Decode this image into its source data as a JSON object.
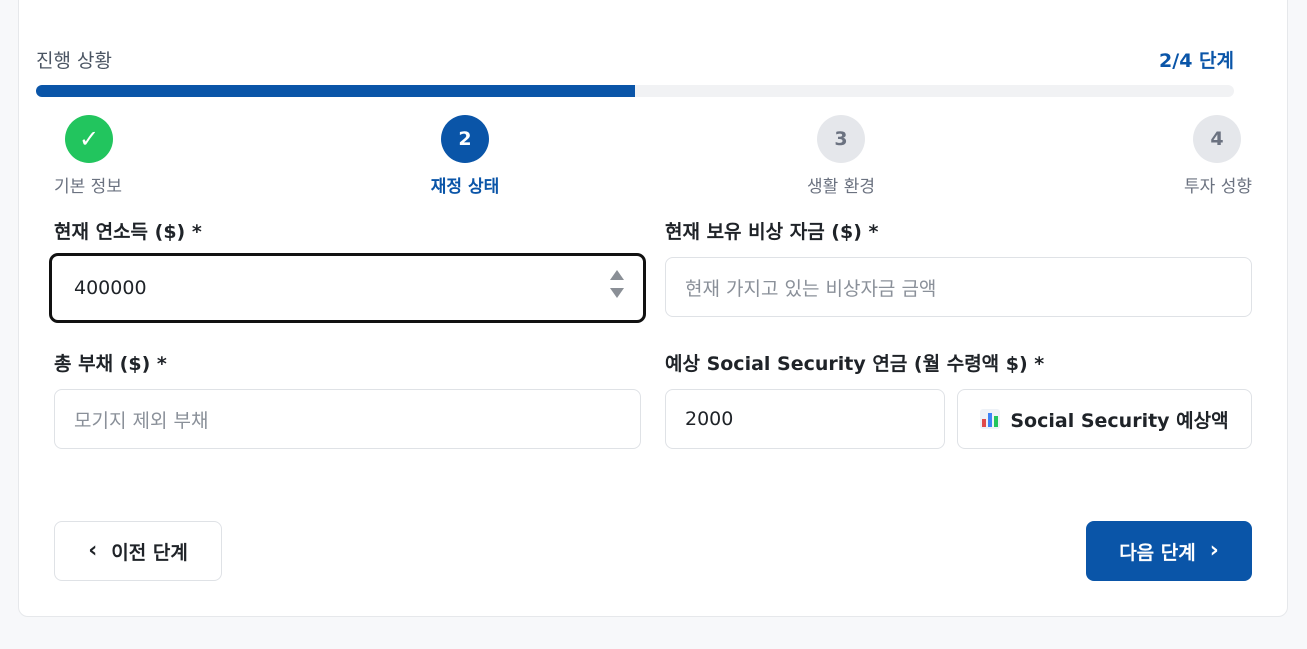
{
  "progress": {
    "title": "진행 상황",
    "count": "2/4 단계",
    "fraction": 0.5,
    "accent_color": "#0a55a8",
    "done_color": "#22c55e"
  },
  "steps": [
    {
      "symbol": "✓",
      "label": "기본 정보",
      "state": "done"
    },
    {
      "symbol": "2",
      "label": "재정 상태",
      "state": "active"
    },
    {
      "symbol": "3",
      "label": "생활 환경",
      "state": "todo"
    },
    {
      "symbol": "4",
      "label": "투자 성향",
      "state": "todo"
    }
  ],
  "form": {
    "annual_income": {
      "label": "현재 연소득 ($) *",
      "value": "400000"
    },
    "emergency_fund": {
      "label": "현재 보유 비상 자금 ($) *",
      "placeholder": "현재 가지고 있는 비상자금 금액"
    },
    "total_debt": {
      "label": "총 부채 ($) *",
      "placeholder": "모기지 제외 부채"
    },
    "social_security": {
      "label": "예상 Social Security 연금 (월 수령액 $) *",
      "value": "2000"
    },
    "ss_estimate_button": {
      "icon": "bar-chart-icon",
      "label": "Social Security 예상액"
    }
  },
  "nav": {
    "prev_label": "이전 단계",
    "prev_icon": "chevron-left-icon",
    "next_label": "다음 단계",
    "next_icon": "chevron-right-icon"
  }
}
